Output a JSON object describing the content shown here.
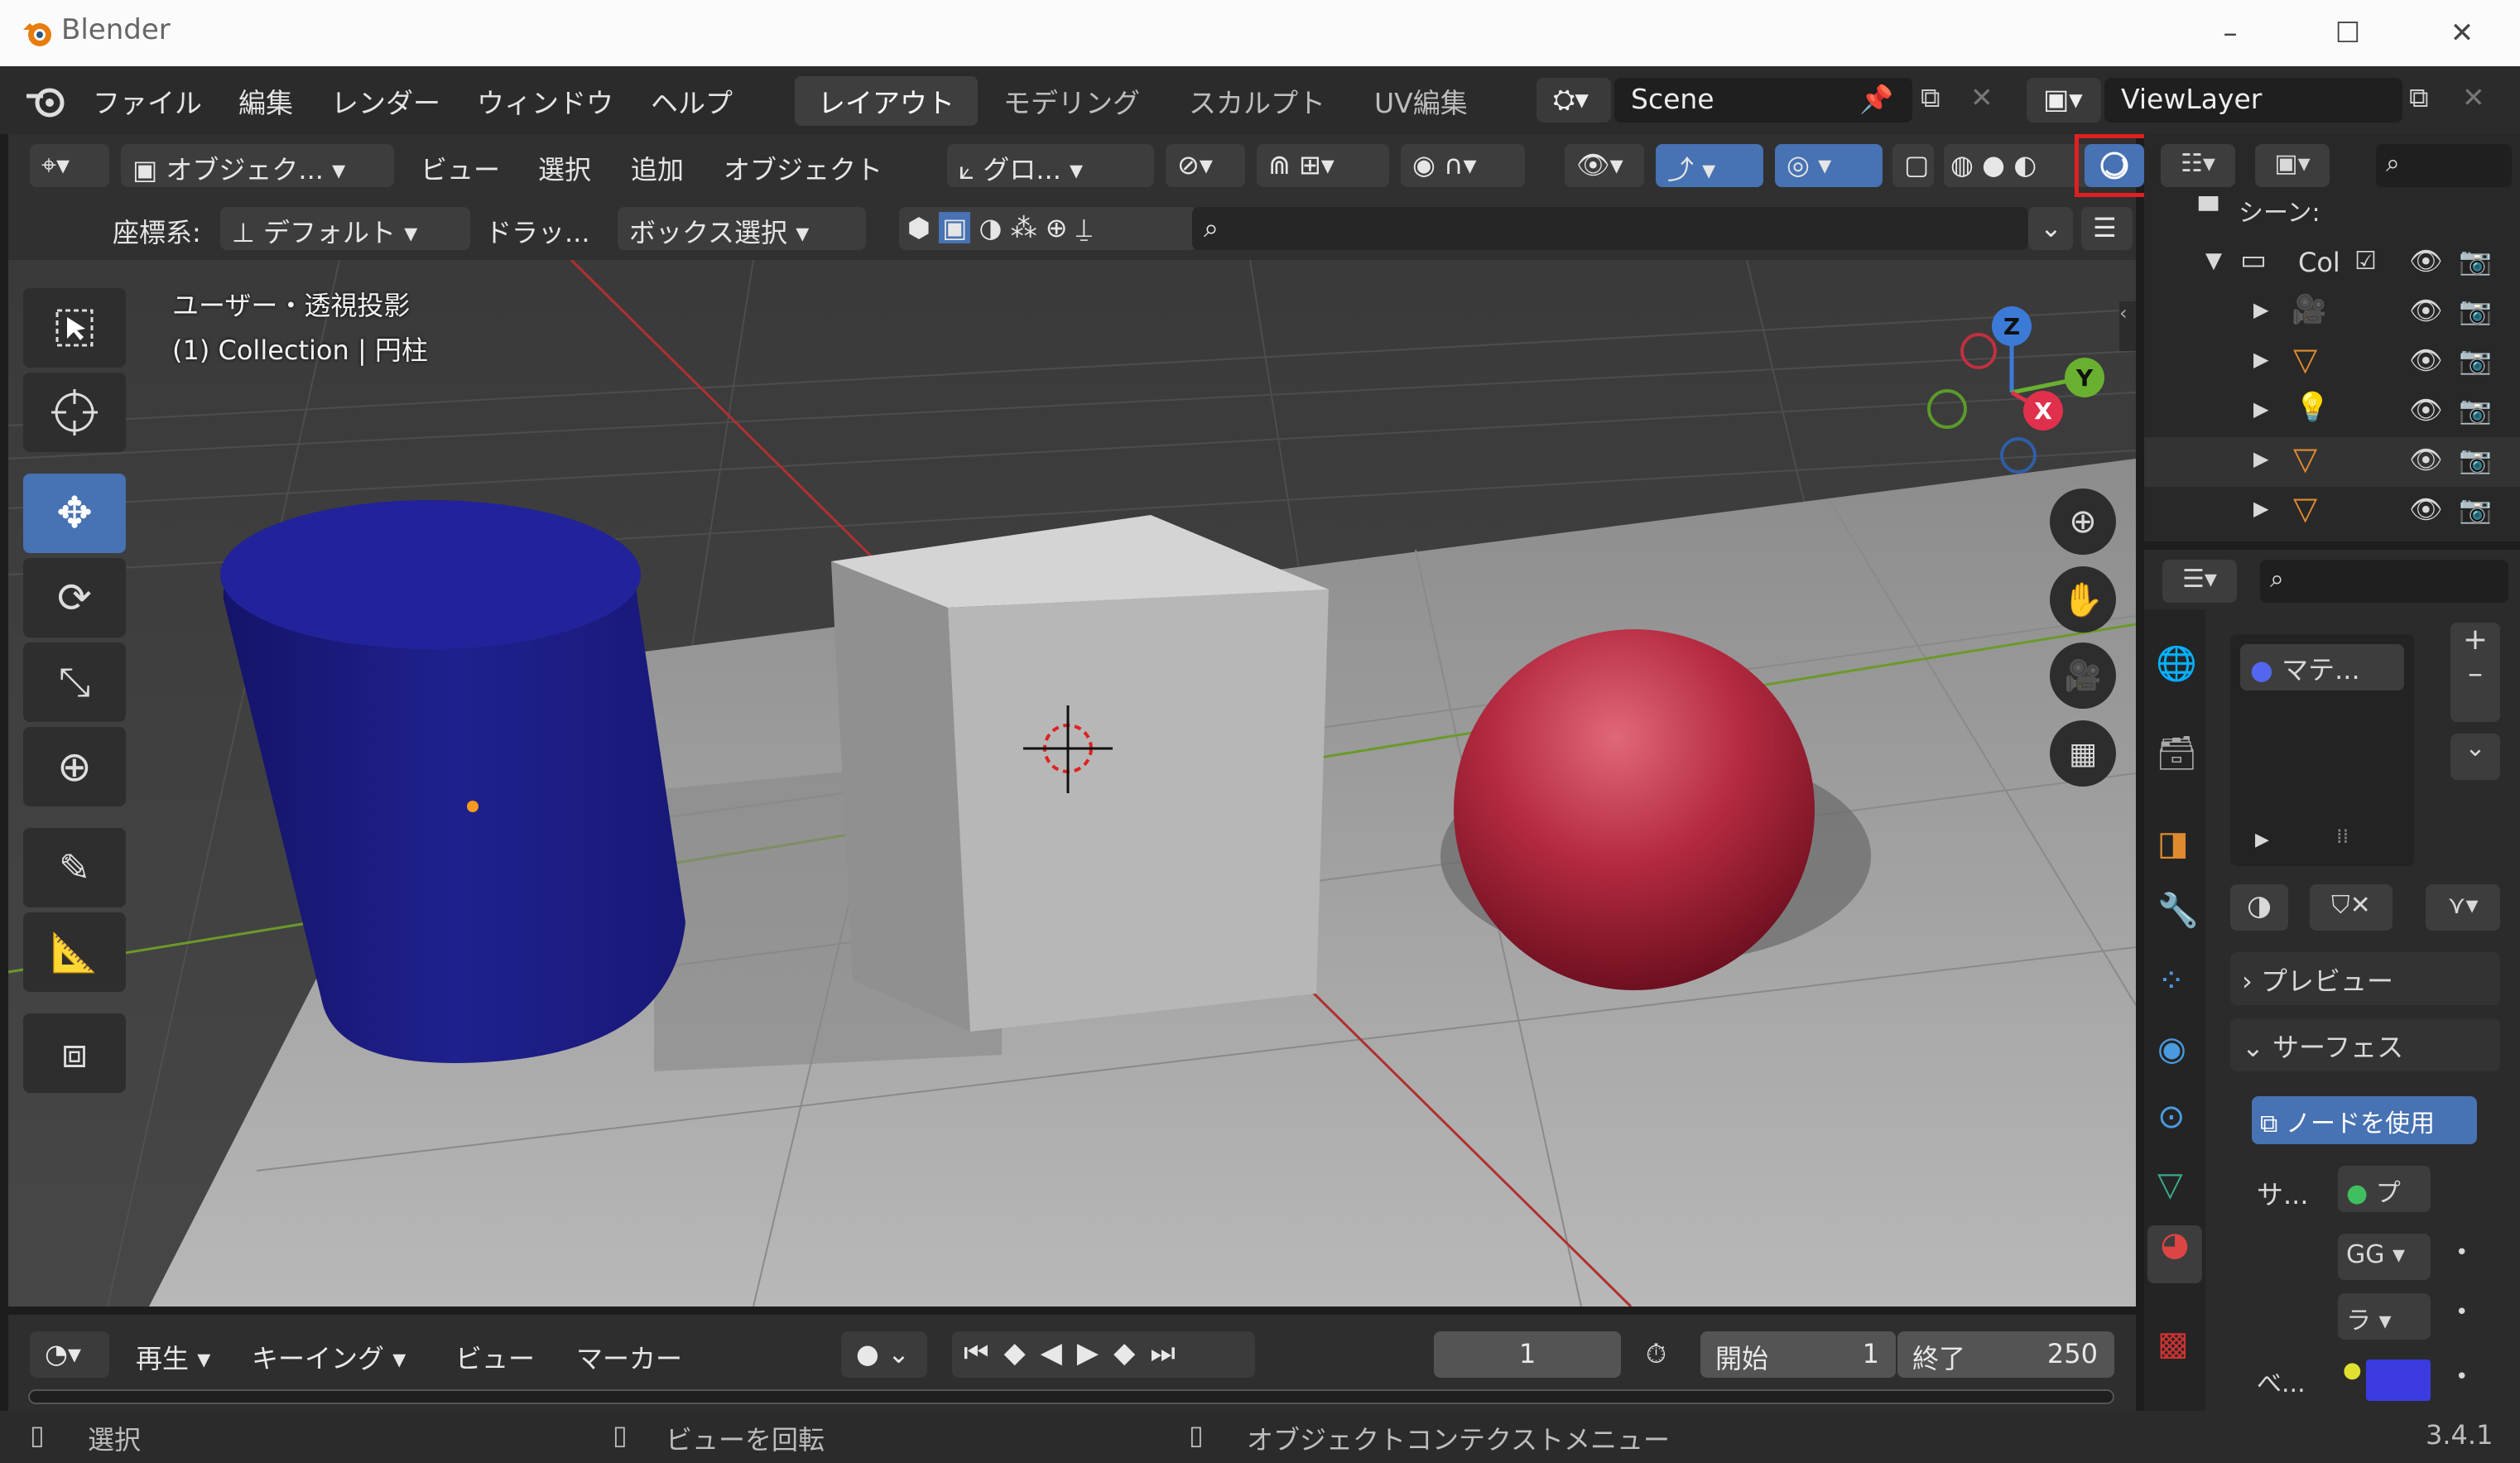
{
  "app": {
    "title": "Blender",
    "version": "3.4.1"
  },
  "menu": {
    "items": [
      "ファイル",
      "編集",
      "レンダー",
      "ウィンドウ",
      "ヘルプ"
    ],
    "workspaces": [
      "レイアウト",
      "モデリング",
      "スカルプト",
      "UV編集"
    ],
    "scene": "Scene",
    "view_layer": "ViewLayer"
  },
  "viewport_header": {
    "mode": "オブジェク...",
    "menus": [
      "ビュー",
      "選択",
      "追加",
      "オブジェクト"
    ],
    "transform_orientation": "グロ...",
    "coord_label": "座標系:",
    "coord_value": "デフォルト",
    "drag_label": "ドラッ...",
    "drag_value": "ボックス選択"
  },
  "viewport": {
    "view_name": "ユーザー・透視投影",
    "collection_info": "(1) Collection | 円柱",
    "gizmo": {
      "x": "X",
      "y": "Y",
      "z": "Z"
    }
  },
  "outliner": {
    "scene_label": "シーン:",
    "collection": "Col"
  },
  "properties": {
    "material": "マテ...",
    "preview_panel": "プレビュー",
    "surface_panel": "サーフェス",
    "use_nodes": "ノードを使用",
    "surface_label": "サ...",
    "surface_value": "プ",
    "gg_label": "GG",
    "ra_label": "ラ",
    "base_label": "べ...",
    "base_color": "#3b3be0"
  },
  "timeline": {
    "playback": "再生",
    "keying": "キーイング",
    "view": "ビュー",
    "marker": "マーカー",
    "current_frame": "1",
    "start_label": "開始",
    "start": "1",
    "end_label": "終了",
    "end": "250"
  },
  "status": {
    "select": "選択",
    "rotate": "ビューを回転",
    "context": "オブジェクトコンテクストメニュー"
  },
  "colors": {
    "accent": "#4772b3",
    "highlight": "#e02020",
    "cylinder": "#1d1d8c",
    "sphere": "#b02035"
  }
}
